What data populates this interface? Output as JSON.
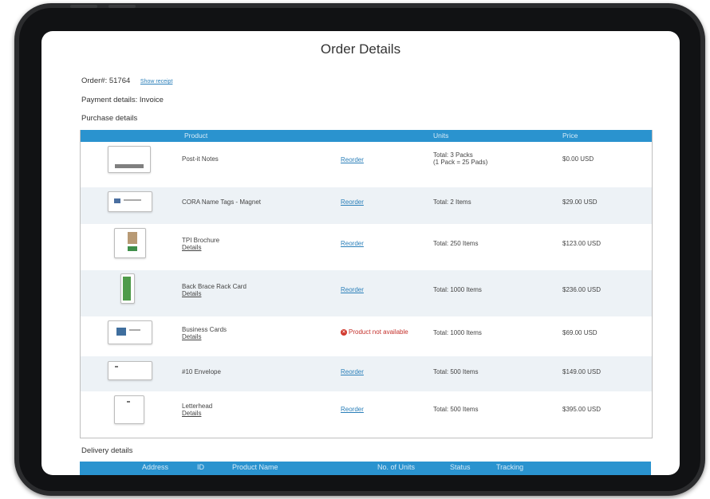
{
  "page": {
    "title": "Order Details",
    "order_label": "Order#:",
    "order_number": "51764",
    "show_receipt": "Show receipt",
    "payment": "Payment details: Invoice",
    "purchase_details": "Purchase details",
    "delivery_details": "Delivery details"
  },
  "purchase_table": {
    "headers": [
      "Product",
      "Units",
      "Price"
    ],
    "reorder_label": "Reorder",
    "details_label": "Details",
    "rows": [
      {
        "product": "Post-it Notes",
        "units": "Total: 3 Packs",
        "units2": "(1 Pack = 25 Pads)",
        "price": "$0.00 USD"
      },
      {
        "product": "CORA Name Tags - Magnet",
        "units": "Total: 2 Items",
        "price": "$29.00 USD"
      },
      {
        "product": "TPI Brochure",
        "units": "Total: 250 Items",
        "price": "$123.00 USD"
      },
      {
        "product": "Back Brace Rack Card",
        "units": "Total: 1000 Items",
        "price": "$236.00 USD"
      },
      {
        "product": "Business Cards",
        "status": "Product not available",
        "units": "Total: 1000 Items",
        "price": "$69.00 USD"
      },
      {
        "product": "#10 Envelope",
        "units": "Total: 500 Items",
        "price": "$149.00 USD"
      },
      {
        "product": "Letterhead",
        "units": "Total: 500 Items",
        "price": "$395.00 USD"
      }
    ]
  },
  "delivery_table": {
    "headers": [
      "Address",
      "ID",
      "Product Name",
      "No. of Units",
      "Status",
      "Tracking"
    ]
  },
  "colors": {
    "header_bar": "#2a93cf",
    "link": "#2a7fb9",
    "error": "#c4302b",
    "alt_row": "#edf2f6"
  }
}
